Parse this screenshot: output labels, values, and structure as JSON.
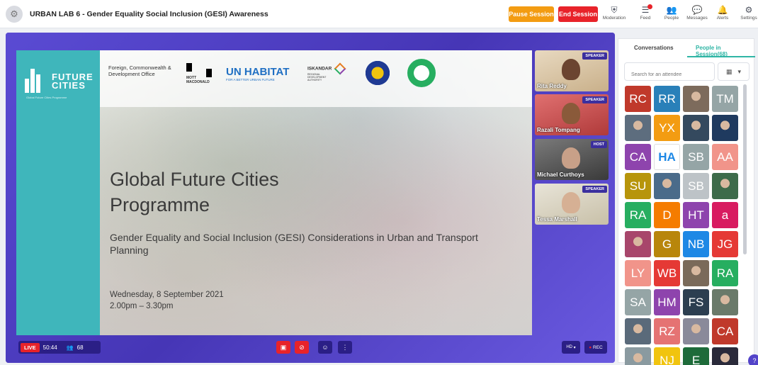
{
  "header": {
    "title": "URBAN LAB 6 - Gender Equality Social Inclusion (GESI) Awareness",
    "pause_label": "Pause Session",
    "end_label": "End Session",
    "nav": [
      {
        "label": "Moderation",
        "icon": "shield-icon"
      },
      {
        "label": "Feed",
        "icon": "feed-icon"
      },
      {
        "label": "People",
        "icon": "people-icon"
      },
      {
        "label": "Messages",
        "icon": "messages-icon"
      },
      {
        "label": "Alerts",
        "icon": "bell-icon"
      },
      {
        "label": "Settings",
        "icon": "gear-icon"
      }
    ]
  },
  "slide": {
    "brand_line1": "FUTURE",
    "brand_line2": "CITIES",
    "brand_tagline": "Global Future Cities Programme",
    "fcdo": "Foreign, Commonwealth & Development Office",
    "mott": "MOTT MACDONALD",
    "unhabitat": "UN HABITAT",
    "unhabitat_sub": "FOR A BETTER URBAN FUTURE",
    "iskandar": "ISKANDAR",
    "iskandar_sub": "REGIONAL DEVELOPMENT AUTHORITY",
    "title_line1": "Global Future Cities",
    "title_line2": "Programme",
    "subtitle": "Gender Equality and Social Inclusion (GESI) Considerations in Urban and Transport Planning",
    "date": "Wednesday, 8 September 2021",
    "time": "2.00pm – 3.30pm"
  },
  "speakers": [
    {
      "name": "Rita Reddy",
      "tag": "SPEAKER"
    },
    {
      "name": "Razali Tompang",
      "tag": "SPEAKER"
    },
    {
      "name": "Michael Curthoys",
      "tag": "HOST"
    },
    {
      "name": "Tessa Marshall",
      "tag": "SPEAKER"
    }
  ],
  "bottom": {
    "live_label": "LIVE",
    "elapsed": "50:44",
    "viewer_count": "68",
    "quality": "HD",
    "rec_label": "REC"
  },
  "sidebar": {
    "tab_conversations": "Conversations",
    "tab_people": "People in Session(68)",
    "search_placeholder": "Search for an attendee",
    "attendees": [
      {
        "initials": "RC",
        "color": "#c0392b"
      },
      {
        "initials": "RR",
        "color": "#2980b9"
      },
      {
        "initials": "",
        "color": "#7d6b5c",
        "photo": true
      },
      {
        "initials": "TM",
        "color": "#95a5a6"
      },
      {
        "initials": "",
        "color": "#5d6d7e",
        "photo": true
      },
      {
        "initials": "YX",
        "color": "#f39c12"
      },
      {
        "initials": "",
        "color": "#34495e",
        "photo": true
      },
      {
        "initials": "",
        "color": "#1f3a5f",
        "photo": true
      },
      {
        "initials": "CA",
        "color": "#8e44ad"
      },
      {
        "initials": "HA",
        "color": "#ffffff",
        "text_color": "#1e88e5"
      },
      {
        "initials": "SB",
        "color": "#95a5a6"
      },
      {
        "initials": "AA",
        "color": "#f1948a"
      },
      {
        "initials": "SU",
        "color": "#b7950b"
      },
      {
        "initials": "",
        "color": "#4a6b8a",
        "photo": true
      },
      {
        "initials": "SB",
        "color": "#bdc3c7"
      },
      {
        "initials": "",
        "color": "#3d6b4a",
        "photo": true
      },
      {
        "initials": "RA",
        "color": "#27ae60"
      },
      {
        "initials": "D",
        "color": "#f57c00"
      },
      {
        "initials": "HT",
        "color": "#8e44ad"
      },
      {
        "initials": "a",
        "color": "#d81b60"
      },
      {
        "initials": "",
        "color": "#a8466b",
        "photo": true
      },
      {
        "initials": "G",
        "color": "#b8860b"
      },
      {
        "initials": "NB",
        "color": "#1e88e5"
      },
      {
        "initials": "JG",
        "color": "#e53935"
      },
      {
        "initials": "LY",
        "color": "#f1948a"
      },
      {
        "initials": "WB",
        "color": "#e53935"
      },
      {
        "initials": "",
        "color": "#7a6a5a",
        "photo": true
      },
      {
        "initials": "RA",
        "color": "#27ae60"
      },
      {
        "initials": "SA",
        "color": "#95a5a6"
      },
      {
        "initials": "HM",
        "color": "#8e44ad"
      },
      {
        "initials": "FS",
        "color": "#2c3e50"
      },
      {
        "initials": "",
        "color": "#6a7a6a",
        "photo": true
      },
      {
        "initials": "",
        "color": "#5a6a7a",
        "photo": true
      },
      {
        "initials": "RZ",
        "color": "#e57373"
      },
      {
        "initials": "",
        "color": "#8a8a9a",
        "photo": true
      },
      {
        "initials": "CA",
        "color": "#c0392b"
      },
      {
        "initials": "",
        "color": "#8a9aa0",
        "photo": true
      },
      {
        "initials": "NJ",
        "color": "#f1c40f"
      },
      {
        "initials": "E",
        "color": "#1e6b3a"
      },
      {
        "initials": "",
        "color": "#2a2a3a",
        "photo": true
      }
    ]
  }
}
